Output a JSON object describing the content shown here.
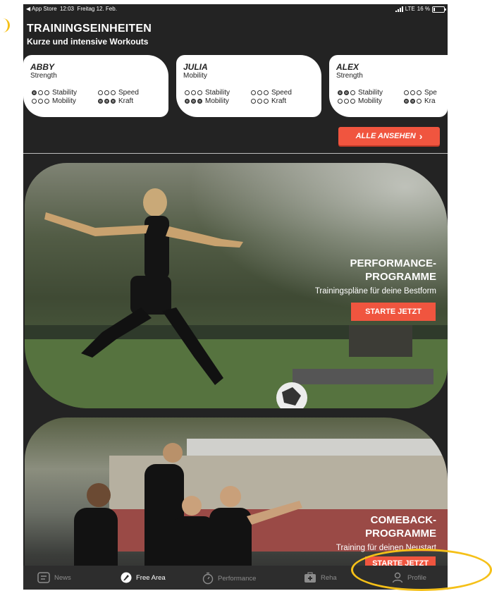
{
  "status_bar": {
    "back_label": "◀ App Store",
    "time": "12:03",
    "date": "Freitag 12. Feb.",
    "network": "LTE",
    "battery": "16 %"
  },
  "section": {
    "title": "TRAININGSEINHEITEN",
    "subtitle": "Kurze und intensive Workouts"
  },
  "cards": [
    {
      "name": "ABBY",
      "type": "Strength",
      "stats": [
        {
          "label": "Stability",
          "level": 1
        },
        {
          "label": "Speed",
          "level": 0
        },
        {
          "label": "Mobility",
          "level": 0
        },
        {
          "label": "Kraft",
          "level": 3
        }
      ]
    },
    {
      "name": "JULIA",
      "type": "Mobility",
      "stats": [
        {
          "label": "Stability",
          "level": 0
        },
        {
          "label": "Speed",
          "level": 0
        },
        {
          "label": "Mobility",
          "level": 3
        },
        {
          "label": "Kraft",
          "level": 0
        }
      ]
    },
    {
      "name": "ALEX",
      "type": "Strength",
      "stats": [
        {
          "label": "Stability",
          "level": 2
        },
        {
          "label": "Spe",
          "level": 0
        },
        {
          "label": "Mobility",
          "level": 0
        },
        {
          "label": "Kra",
          "level": 2
        }
      ]
    }
  ],
  "all_button": {
    "label": "ALLE ANSEHEN",
    "chevron": "›"
  },
  "banners": [
    {
      "title_line1": "PERFORMANCE-",
      "title_line2": "PROGRAMME",
      "subtitle": "Trainingspläne für deine Bestform",
      "button": "STARTE JETZT"
    },
    {
      "title_line1": "COMEBACK-",
      "title_line2": "PROGRAMME",
      "subtitle": "Training für deinen Neustart",
      "button": "STARTE JETZT"
    }
  ],
  "tabs": [
    {
      "label": "News",
      "icon": "news-icon",
      "active": false
    },
    {
      "label": "Free Area",
      "icon": "free-area-icon",
      "active": true
    },
    {
      "label": "Performance",
      "icon": "stopwatch-icon",
      "active": false
    },
    {
      "label": "Reha",
      "icon": "first-aid-icon",
      "active": false
    },
    {
      "label": "Profile",
      "icon": "profile-icon",
      "active": false
    }
  ],
  "colors": {
    "background": "#232323",
    "accent": "#f0553f",
    "card": "#ffffff",
    "tab_inactive": "#8c8c8c",
    "annotation": "#f5c018"
  }
}
